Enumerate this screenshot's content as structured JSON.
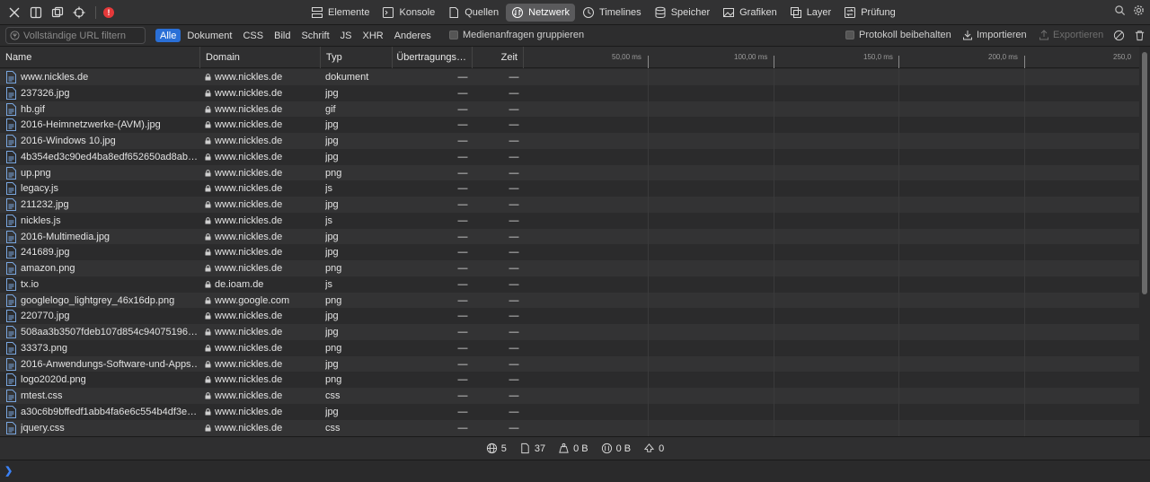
{
  "tabs": [
    {
      "label": "Elemente",
      "icon": "elements-icon"
    },
    {
      "label": "Konsole",
      "icon": "console-icon"
    },
    {
      "label": "Quellen",
      "icon": "sources-icon"
    },
    {
      "label": "Netzwerk",
      "icon": "network-icon",
      "active": true
    },
    {
      "label": "Timelines",
      "icon": "timelines-icon"
    },
    {
      "label": "Speicher",
      "icon": "storage-icon"
    },
    {
      "label": "Grafiken",
      "icon": "graphics-icon"
    },
    {
      "label": "Layer",
      "icon": "layers-icon"
    },
    {
      "label": "Prüfung",
      "icon": "audit-icon"
    }
  ],
  "error_count": "!",
  "filter": {
    "placeholder": "Vollständige URL filtern",
    "types": [
      "Alle",
      "Dokument",
      "CSS",
      "Bild",
      "Schrift",
      "JS",
      "XHR",
      "Anderes"
    ],
    "active_type": "Alle",
    "group_media_label": "Medienanfragen gruppieren",
    "preserve_log_label": "Protokoll beibehalten",
    "import_label": "Importieren",
    "export_label": "Exportieren"
  },
  "columns": {
    "name": "Name",
    "domain": "Domain",
    "type": "Typ",
    "transfer": "Übertragungs…",
    "time": "Zeit"
  },
  "waterfall_ticks": [
    "50,00 ms",
    "100,00 ms",
    "150,0 ms",
    "200,0 ms",
    "250,0 ms"
  ],
  "rows": [
    {
      "name": "www.nickles.de",
      "domain": "www.nickles.de",
      "type": "dokument",
      "transfer": "—",
      "time": "—"
    },
    {
      "name": "237326.jpg",
      "domain": "www.nickles.de",
      "type": "jpg",
      "transfer": "—",
      "time": "—"
    },
    {
      "name": "hb.gif",
      "domain": "www.nickles.de",
      "type": "gif",
      "transfer": "—",
      "time": "—"
    },
    {
      "name": "2016-Heimnetzwerke-(AVM).jpg",
      "domain": "www.nickles.de",
      "type": "jpg",
      "transfer": "—",
      "time": "—"
    },
    {
      "name": "2016-Windows 10.jpg",
      "domain": "www.nickles.de",
      "type": "jpg",
      "transfer": "—",
      "time": "—"
    },
    {
      "name": "4b354ed3c90ed4ba8edf652650ad8ab…",
      "domain": "www.nickles.de",
      "type": "jpg",
      "transfer": "—",
      "time": "—"
    },
    {
      "name": "up.png",
      "domain": "www.nickles.de",
      "type": "png",
      "transfer": "—",
      "time": "—"
    },
    {
      "name": "legacy.js",
      "domain": "www.nickles.de",
      "type": "js",
      "transfer": "—",
      "time": "—"
    },
    {
      "name": "211232.jpg",
      "domain": "www.nickles.de",
      "type": "jpg",
      "transfer": "—",
      "time": "—"
    },
    {
      "name": "nickles.js",
      "domain": "www.nickles.de",
      "type": "js",
      "transfer": "—",
      "time": "—"
    },
    {
      "name": "2016-Multimedia.jpg",
      "domain": "www.nickles.de",
      "type": "jpg",
      "transfer": "—",
      "time": "—"
    },
    {
      "name": "241689.jpg",
      "domain": "www.nickles.de",
      "type": "jpg",
      "transfer": "—",
      "time": "—"
    },
    {
      "name": "amazon.png",
      "domain": "www.nickles.de",
      "type": "png",
      "transfer": "—",
      "time": "—"
    },
    {
      "name": "tx.io",
      "domain": "de.ioam.de",
      "type": "js",
      "transfer": "—",
      "time": "—"
    },
    {
      "name": "googlelogo_lightgrey_46x16dp.png",
      "domain": "www.google.com",
      "type": "png",
      "transfer": "—",
      "time": "—"
    },
    {
      "name": "220770.jpg",
      "domain": "www.nickles.de",
      "type": "jpg",
      "transfer": "—",
      "time": "—"
    },
    {
      "name": "508aa3b3507fdeb107d854c94075196…",
      "domain": "www.nickles.de",
      "type": "jpg",
      "transfer": "—",
      "time": "—"
    },
    {
      "name": "33373.png",
      "domain": "www.nickles.de",
      "type": "png",
      "transfer": "—",
      "time": "—"
    },
    {
      "name": "2016-Anwendungs-Software-und-Apps…",
      "domain": "www.nickles.de",
      "type": "jpg",
      "transfer": "—",
      "time": "—"
    },
    {
      "name": "logo2020d.png",
      "domain": "www.nickles.de",
      "type": "png",
      "transfer": "—",
      "time": "—"
    },
    {
      "name": "mtest.css",
      "domain": "www.nickles.de",
      "type": "css",
      "transfer": "—",
      "time": "—"
    },
    {
      "name": "a30c6b9bffedf1abb4fa6e6c554b4df3e…",
      "domain": "www.nickles.de",
      "type": "jpg",
      "transfer": "—",
      "time": "—"
    },
    {
      "name": "jquery.css",
      "domain": "www.nickles.de",
      "type": "css",
      "transfer": "—",
      "time": "—"
    }
  ],
  "summary": {
    "domains": "5",
    "resources": "37",
    "transferred": "0 B",
    "size": "0 B",
    "errors": "0"
  },
  "colors": {
    "accent": "#2a6fd6",
    "error": "#e5393a",
    "prompt": "#3b82f6"
  }
}
